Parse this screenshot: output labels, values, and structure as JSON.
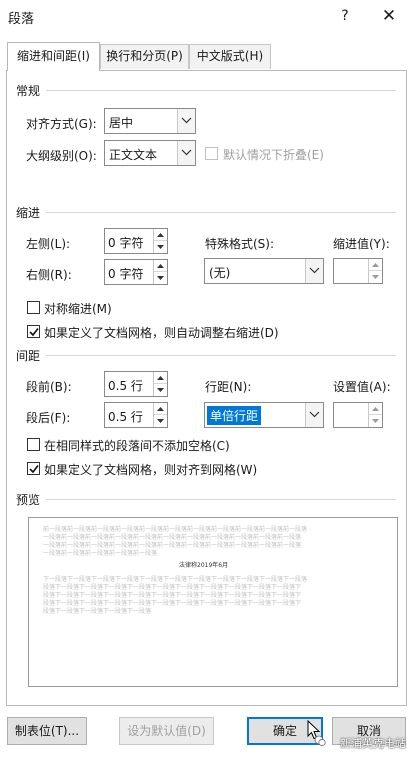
{
  "window": {
    "title": "段落",
    "help": "?",
    "close": "✕"
  },
  "tabs": [
    {
      "label": "缩进和间距(I)",
      "active": true
    },
    {
      "label": "换行和分页(P)",
      "active": false
    },
    {
      "label": "中文版式(H)",
      "active": false
    }
  ],
  "general": {
    "header": "常规",
    "alignment_label": "对齐方式(G):",
    "alignment_value": "居中",
    "outline_label": "大纲级别(O):",
    "outline_value": "正文文本",
    "collapse_label": "默认情况下折叠(E)"
  },
  "indent": {
    "header": "缩进",
    "left_label": "左侧(L):",
    "left_value": "0 字符",
    "right_label": "右侧(R):",
    "right_value": "0 字符",
    "special_label": "特殊格式(S):",
    "special_value": "(无)",
    "by_label": "缩进值(Y):",
    "by_value": "",
    "mirror_label": "对称缩进(M)",
    "auto_adjust_label": "如果定义了文档网格，则自动调整右缩进(D)"
  },
  "spacing": {
    "header": "间距",
    "before_label": "段前(B):",
    "before_value": "0.5 行",
    "after_label": "段后(F):",
    "after_value": "0.5 行",
    "line_label": "行距(N):",
    "line_value": "单倍行距",
    "at_label": "设置值(A):",
    "at_value": "",
    "no_space_label": "在相同样式的段落间不添加空格(C)",
    "snap_grid_label": "如果定义了文档网格，则对齐到网格(W)"
  },
  "preview": {
    "header": "预览",
    "prev_lines": [
      "前一段落前一段落前一段落前一段落前一段落前一段落前一段落前一段落前一段落前一段落前一段落",
      "一段落前一段落前一段落前一段落前一段落前一段落前一段落前一段落前一段落前一段落前一段落",
      "一段落前一段落前一段落前一段落前一段落前一段落前一段落前一段落前一段落前一段落前一段落",
      "一段落前一段落前一段落前一段落前一段落"
    ],
    "sample_text": "法律称2019年6月",
    "next_lines": [
      "下一段落下一段落下一段落下一段落下一段落下一段落下一段落下一段落下一段落下一段落下一段落",
      "段落下一段落下一段落下一段落下一段落下一段落下一段落下一段落下一段落下一段落下一段落下",
      "段落下一段落下一段落下一段落下一段落下一段落下一段落下一段落下一段落下一段落下一段落下",
      "段落下一段落下一段落下一段落下一段落下一段落下一段落下一段落下一段落下一段落下一段落下",
      "段落下一段落下一段落下一段落下一段落"
    ]
  },
  "buttons": {
    "tabs": "制表位(T)...",
    "set_default": "设为默认值(D)",
    "ok": "确定",
    "cancel": "取消"
  },
  "watermark": "新浦英克电站",
  "colors": {
    "accent": "#0078d7",
    "selection": "#0078d7"
  }
}
